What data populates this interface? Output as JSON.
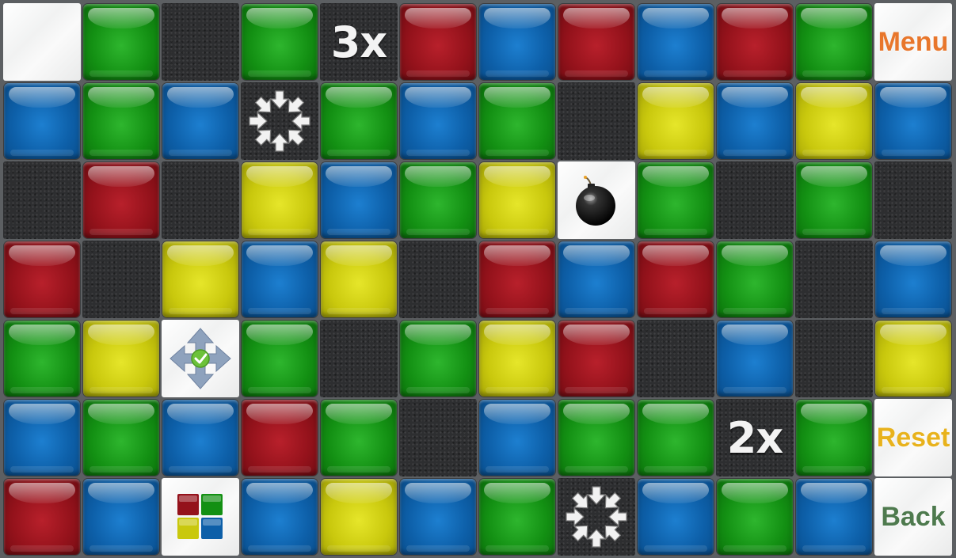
{
  "board": {
    "columns": 12,
    "rows": 7,
    "tiles": [
      [
        "blank",
        "green",
        "empty",
        "green",
        "mult3",
        "red",
        "blue",
        "red",
        "blue",
        "red",
        "green",
        "menu"
      ],
      [
        "blue",
        "green",
        "blue",
        "implode",
        "green",
        "blue",
        "green",
        "empty",
        "yellow",
        "blue",
        "yellow",
        "blue"
      ],
      [
        "empty",
        "red",
        "empty",
        "yellow",
        "blue",
        "green",
        "yellow",
        "bomb",
        "green",
        "empty",
        "green",
        "empty"
      ],
      [
        "red",
        "empty",
        "yellow",
        "blue",
        "yellow",
        "empty",
        "red",
        "blue",
        "red",
        "green",
        "empty",
        "blue"
      ],
      [
        "green",
        "yellow",
        "move",
        "green",
        "empty",
        "green",
        "yellow",
        "red",
        "empty",
        "blue",
        "empty",
        "yellow"
      ],
      [
        "blue",
        "green",
        "blue",
        "red",
        "green",
        "empty",
        "blue",
        "green",
        "green",
        "mult2",
        "green",
        "reset"
      ],
      [
        "red",
        "blue",
        "colors",
        "blue",
        "yellow",
        "blue",
        "green",
        "implode",
        "blue",
        "green",
        "blue",
        "back"
      ]
    ]
  },
  "labels": {
    "mult3": "3x",
    "mult2": "2x",
    "menu": "Menu",
    "reset": "Reset",
    "back": "Back"
  },
  "label_colors": {
    "menu": "#e8762b",
    "reset": "#e8b21c",
    "back": "#4e7a4e"
  },
  "icons": {
    "implode": "implode-arrows-icon",
    "bomb": "bomb-icon",
    "move": "move-arrows-check-icon",
    "colors": "four-colors-icon"
  },
  "colors": {
    "green": "#139013",
    "blue": "#0d5fa8",
    "red": "#94121b",
    "yellow": "#c9c80d"
  }
}
